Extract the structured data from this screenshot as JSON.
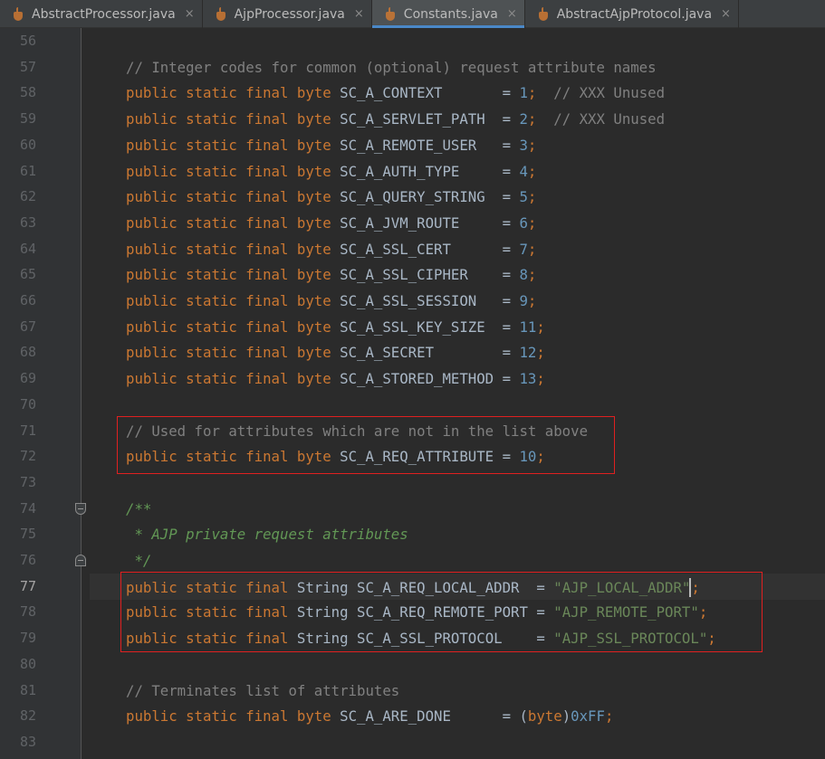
{
  "tabs": [
    {
      "label": "AbstractProcessor.java",
      "active": false
    },
    {
      "label": "AjpProcessor.java",
      "active": false
    },
    {
      "label": "Constants.java",
      "active": true
    },
    {
      "label": "AbstractAjpProtocol.java",
      "active": false
    }
  ],
  "tab_close_glyph": "×",
  "lines": [
    {
      "num": "56",
      "parts": []
    },
    {
      "num": "57",
      "parts": [
        [
          "cm",
          "// Integer codes for common (optional) request attribute names"
        ]
      ]
    },
    {
      "num": "58",
      "parts": [
        [
          "kw",
          "public static final byte "
        ],
        [
          "id",
          "SC_A_CONTEXT       = "
        ],
        [
          "num",
          "1"
        ],
        [
          "kw",
          ";"
        ],
        [
          "cm",
          "  // XXX Unused"
        ]
      ]
    },
    {
      "num": "59",
      "parts": [
        [
          "kw",
          "public static final byte "
        ],
        [
          "id",
          "SC_A_SERVLET_PATH  = "
        ],
        [
          "num",
          "2"
        ],
        [
          "kw",
          ";"
        ],
        [
          "cm",
          "  // XXX Unused"
        ]
      ]
    },
    {
      "num": "60",
      "parts": [
        [
          "kw",
          "public static final byte "
        ],
        [
          "id",
          "SC_A_REMOTE_USER   = "
        ],
        [
          "num",
          "3"
        ],
        [
          "kw",
          ";"
        ]
      ]
    },
    {
      "num": "61",
      "parts": [
        [
          "kw",
          "public static final byte "
        ],
        [
          "id",
          "SC_A_AUTH_TYPE     = "
        ],
        [
          "num",
          "4"
        ],
        [
          "kw",
          ";"
        ]
      ]
    },
    {
      "num": "62",
      "parts": [
        [
          "kw",
          "public static final byte "
        ],
        [
          "id",
          "SC_A_QUERY_STRING  = "
        ],
        [
          "num",
          "5"
        ],
        [
          "kw",
          ";"
        ]
      ]
    },
    {
      "num": "63",
      "parts": [
        [
          "kw",
          "public static final byte "
        ],
        [
          "id",
          "SC_A_JVM_ROUTE     = "
        ],
        [
          "num",
          "6"
        ],
        [
          "kw",
          ";"
        ]
      ]
    },
    {
      "num": "64",
      "parts": [
        [
          "kw",
          "public static final byte "
        ],
        [
          "id",
          "SC_A_SSL_CERT      = "
        ],
        [
          "num",
          "7"
        ],
        [
          "kw",
          ";"
        ]
      ]
    },
    {
      "num": "65",
      "parts": [
        [
          "kw",
          "public static final byte "
        ],
        [
          "id",
          "SC_A_SSL_CIPHER    = "
        ],
        [
          "num",
          "8"
        ],
        [
          "kw",
          ";"
        ]
      ]
    },
    {
      "num": "66",
      "parts": [
        [
          "kw",
          "public static final byte "
        ],
        [
          "id",
          "SC_A_SSL_SESSION   = "
        ],
        [
          "num",
          "9"
        ],
        [
          "kw",
          ";"
        ]
      ]
    },
    {
      "num": "67",
      "parts": [
        [
          "kw",
          "public static final byte "
        ],
        [
          "id",
          "SC_A_SSL_KEY_SIZE  = "
        ],
        [
          "num",
          "11"
        ],
        [
          "kw",
          ";"
        ]
      ]
    },
    {
      "num": "68",
      "parts": [
        [
          "kw",
          "public static final byte "
        ],
        [
          "id",
          "SC_A_SECRET        = "
        ],
        [
          "num",
          "12"
        ],
        [
          "kw",
          ";"
        ]
      ]
    },
    {
      "num": "69",
      "parts": [
        [
          "kw",
          "public static final byte "
        ],
        [
          "id",
          "SC_A_STORED_METHOD = "
        ],
        [
          "num",
          "13"
        ],
        [
          "kw",
          ";"
        ]
      ]
    },
    {
      "num": "70",
      "parts": []
    },
    {
      "num": "71",
      "parts": [
        [
          "cm",
          "// Used for attributes which are not in the list above"
        ]
      ]
    },
    {
      "num": "72",
      "parts": [
        [
          "kw",
          "public static final byte "
        ],
        [
          "id",
          "SC_A_REQ_ATTRIBUTE = "
        ],
        [
          "num",
          "10"
        ],
        [
          "kw",
          ";"
        ]
      ]
    },
    {
      "num": "73",
      "parts": []
    },
    {
      "num": "74",
      "parts": [
        [
          "doc",
          "/**"
        ]
      ]
    },
    {
      "num": "75",
      "parts": [
        [
          "doc",
          " * AJP private request attributes"
        ]
      ]
    },
    {
      "num": "76",
      "parts": [
        [
          "doc",
          " */"
        ]
      ]
    },
    {
      "num": "77",
      "parts": [
        [
          "kw",
          "public static final "
        ],
        [
          "ty",
          "String "
        ],
        [
          "id",
          "SC_A_REQ_LOCAL_ADDR  = "
        ],
        [
          "str",
          "\"AJP_LOCAL_ADDR\""
        ],
        [
          "kw",
          ";"
        ]
      ],
      "current": true
    },
    {
      "num": "78",
      "parts": [
        [
          "kw",
          "public static final "
        ],
        [
          "ty",
          "String "
        ],
        [
          "id",
          "SC_A_REQ_REMOTE_PORT = "
        ],
        [
          "str",
          "\"AJP_REMOTE_PORT\""
        ],
        [
          "kw",
          ";"
        ]
      ]
    },
    {
      "num": "79",
      "parts": [
        [
          "kw",
          "public static final "
        ],
        [
          "ty",
          "String "
        ],
        [
          "id",
          "SC_A_SSL_PROTOCOL    = "
        ],
        [
          "str",
          "\"AJP_SSL_PROTOCOL\""
        ],
        [
          "kw",
          ";"
        ]
      ]
    },
    {
      "num": "80",
      "parts": []
    },
    {
      "num": "81",
      "parts": [
        [
          "cm",
          "// Terminates list of attributes"
        ]
      ]
    },
    {
      "num": "82",
      "parts": [
        [
          "kw",
          "public static final byte "
        ],
        [
          "id",
          "SC_A_ARE_DONE      = ("
        ],
        [
          "kw",
          "byte"
        ],
        [
          "id",
          ")"
        ],
        [
          "num",
          "0xFF"
        ],
        [
          "kw",
          ";"
        ]
      ]
    },
    {
      "num": "83",
      "parts": []
    }
  ],
  "fold_markers": {
    "74": "open",
    "76": "close"
  }
}
